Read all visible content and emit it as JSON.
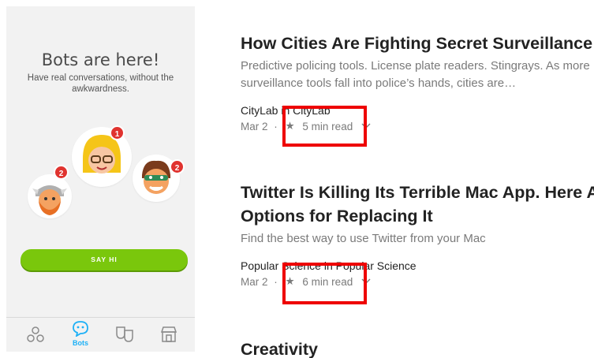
{
  "phone": {
    "title": "Bots are here!",
    "subtitle": "Have real conversations, without the awkwardness.",
    "bots": [
      {
        "name": "viking-bot",
        "badge": "2"
      },
      {
        "name": "blonde-bot",
        "badge": "1"
      },
      {
        "name": "masked-bot",
        "badge": "2"
      }
    ],
    "say_hi_label": "SAY HI",
    "tabs": [
      {
        "icon": "circles-icon",
        "label": ""
      },
      {
        "icon": "chat-bot-icon",
        "label": "Bots"
      },
      {
        "icon": "masks-icon",
        "label": ""
      },
      {
        "icon": "store-icon",
        "label": ""
      }
    ],
    "colors": {
      "accent": "#7ac70c",
      "badge": "#e0332f",
      "active_tab": "#1cb0f6"
    }
  },
  "feed": {
    "articles": [
      {
        "title": "How Cities Are Fighting Secret Surveillance",
        "desc_line1": "Predictive policing tools. License plate readers. Stingrays. As more",
        "desc_line2": "surveillance tools fall into police’s hands, cities are…",
        "source": "CityLab in CityLab",
        "date": "Mar 2",
        "separator": "·",
        "star": "★",
        "read_time": "5 min read"
      },
      {
        "title_line1": "Twitter Is Killing Its Terrible Mac App. Here Ar",
        "title_line2": "Options for Replacing It",
        "desc_line1": "Find the best way to use Twitter from your Mac",
        "source": "Popular Science in Popular Science",
        "date": "Mar 2",
        "separator": "·",
        "star": "★",
        "read_time": "6 min read"
      },
      {
        "title": "Creativity"
      }
    ],
    "highlight_color": "#ee0000"
  }
}
